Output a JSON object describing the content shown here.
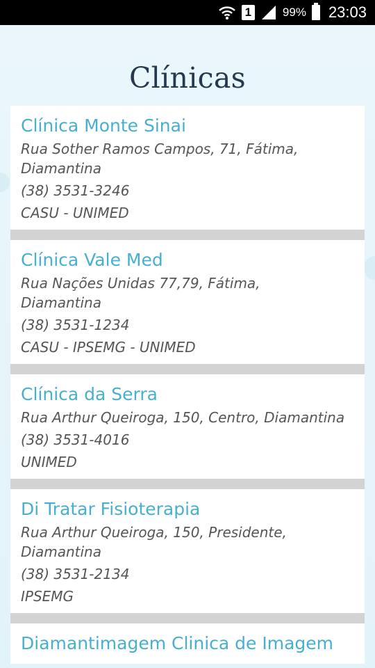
{
  "status_bar": {
    "sim": "1",
    "battery": "99%",
    "time": "23:03"
  },
  "page": {
    "title": "Clínicas"
  },
  "clinics": [
    {
      "name": "Clínica Monte Sinai",
      "address_line1": "Rua Sother Ramos Campos, 71, Fátima,",
      "address_line2": "Diamantina",
      "phone": "(38) 3531-3246",
      "insurance": "CASU - UNIMED"
    },
    {
      "name": "Clínica Vale Med",
      "address_line1": "Rua Nações Unidas 77,79, Fátima,",
      "address_line2": "Diamantina",
      "phone": "(38) 3531-1234",
      "insurance": "CASU - IPSEMG - UNIMED"
    },
    {
      "name": "Clínica da Serra",
      "address_line1": "Rua Arthur Queiroga, 150, Centro, Diamantina",
      "address_line2": "",
      "phone": "(38) 3531-4016",
      "insurance": "UNIMED"
    },
    {
      "name": "Di Tratar Fisioterapia",
      "address_line1": "Rua Arthur Queiroga, 150, Presidente,",
      "address_line2": "Diamantina",
      "phone": "(38) 3531-2134",
      "insurance": "IPSEMG"
    },
    {
      "name": "Diamantimagem Clinica de Imagem",
      "address_line1": "",
      "address_line2": "",
      "phone": "",
      "insurance": ""
    }
  ]
}
